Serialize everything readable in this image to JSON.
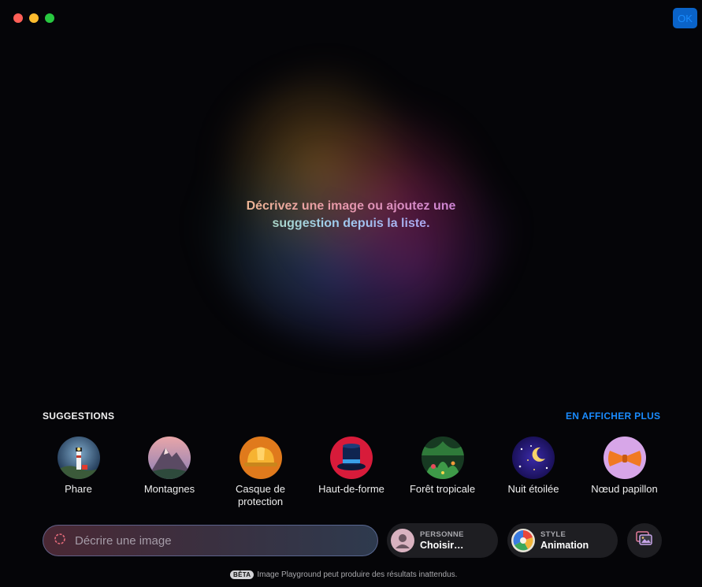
{
  "toolbar": {
    "ok_label": "OK"
  },
  "prompt": {
    "line1": "Décrivez une image ou ajoutez une",
    "line2": "suggestion depuis la liste."
  },
  "suggestions": {
    "title": "SUGGESTIONS",
    "more_label": "EN AFFICHER PLUS",
    "items": [
      {
        "label": "Phare"
      },
      {
        "label": "Montagnes"
      },
      {
        "label": "Casque de protection"
      },
      {
        "label": "Haut-de-forme"
      },
      {
        "label": "Forêt tropicale"
      },
      {
        "label": "Nuit étoilée"
      },
      {
        "label": "Nœud papillon"
      }
    ]
  },
  "input": {
    "placeholder": "Décrire une image",
    "value": ""
  },
  "person": {
    "caption": "PERSONNE",
    "value": "Choisir…"
  },
  "style": {
    "caption": "STYLE",
    "value": "Animation"
  },
  "footer": {
    "badge": "BÊTA",
    "text": "Image Playground peut produire des résultats inattendus."
  },
  "colors": {
    "accent": "#1a8cff",
    "close": "#ff5f57",
    "minimize": "#febc2e",
    "zoom": "#28c840"
  }
}
